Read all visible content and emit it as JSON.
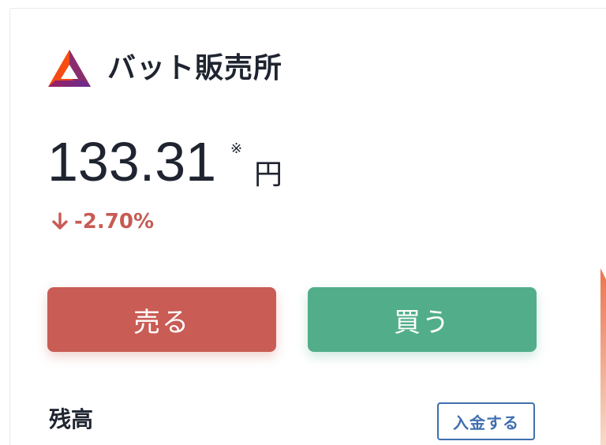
{
  "header": {
    "logo_icon": "bat-triangle-logo-icon",
    "title": "バット販売所"
  },
  "price": {
    "value": "133.31",
    "note_mark": "※",
    "unit": "円"
  },
  "change": {
    "direction_icon": "arrow-down-icon",
    "text": "-2.70%",
    "color": "#c75b55"
  },
  "actions": {
    "sell_label": "売る",
    "buy_label": "買う",
    "sell_color": "#c95c55",
    "buy_color": "#52ae8a"
  },
  "balance": {
    "label": "残高",
    "deposit_label": "入金する",
    "deposit_color": "#3f6fae"
  }
}
